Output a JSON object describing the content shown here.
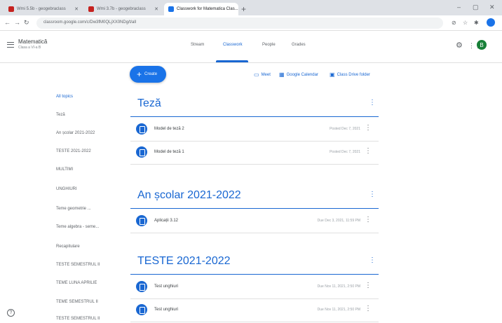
{
  "browser": {
    "tabs": [
      {
        "title": "Wmi 5.5b - geogebraclass",
        "favicon_color": "#c5221f",
        "active": false
      },
      {
        "title": "Wmi 3.7b - geogebraclass",
        "favicon_color": "#c5221f",
        "active": false
      },
      {
        "title": "Classwork for Matematica Clas...",
        "favicon_color": "#1a73e8",
        "active": true
      }
    ],
    "new_tab_symbol": "+",
    "window_controls": {
      "minimize": "–",
      "maximize": "▢",
      "close": "✕"
    },
    "nav": {
      "back": "←",
      "forward": "→",
      "reload": "↻"
    },
    "url": "classroom.google.com/c/Dw3fM0QLjXX0NDg/t/all"
  },
  "header": {
    "class_name": "Matematică",
    "class_section": "Clasa a VI-a B",
    "tabs": [
      {
        "label": "Stream",
        "active": false
      },
      {
        "label": "Classwork",
        "active": true
      },
      {
        "label": "People",
        "active": false
      },
      {
        "label": "Grades",
        "active": false
      }
    ],
    "avatar_letter": "B",
    "avatar_color": "#188038"
  },
  "toolbar": {
    "create_label": "Create",
    "meet_label": "Meet",
    "calendar_label": "Google Calendar",
    "drive_label": "Class Drive folder"
  },
  "topics": [
    {
      "label": "All topics",
      "active": true
    },
    {
      "label": "Teză",
      "active": false
    },
    {
      "label": "An școlar 2021-2022",
      "active": false
    },
    {
      "label": "TESTE 2021-2022",
      "active": false
    },
    {
      "label": "MULTIMI",
      "active": false
    },
    {
      "label": "UNGHIURI",
      "active": false
    },
    {
      "label": "Teme geometrie ...",
      "active": false
    },
    {
      "label": "Teme algebra - seme...",
      "active": false
    },
    {
      "label": "Recapitulare",
      "active": false
    },
    {
      "label": "TESTE SEMESTRUL II",
      "active": false
    },
    {
      "label": "TEME LUNA APRILIE",
      "active": false
    },
    {
      "label": "TEME SEMESTRUL II",
      "active": false
    },
    {
      "label": "TESTE SEMESTRUL II",
      "active": false
    }
  ],
  "sections": [
    {
      "title": "Teză",
      "items": [
        {
          "title": "Model de teză 2",
          "date": "Posted Dec 7, 2021"
        },
        {
          "title": "Model de teză 1",
          "date": "Posted Dec 7, 2021"
        }
      ]
    },
    {
      "title": "An școlar 2021-2022",
      "items": [
        {
          "title": "Aplicații 3.12",
          "date": "Due Dec 3, 2021, 11:59 PM"
        }
      ]
    },
    {
      "title": "TESTE 2021-2022",
      "items": [
        {
          "title": "Test unghiuri",
          "date": "Due Nov 11, 2021, 2:50 PM"
        },
        {
          "title": "Test unghiuri",
          "date": "Due Nov 11, 2021, 2:50 PM"
        }
      ]
    }
  ],
  "help_symbol": "?",
  "accent_color": "#1967d2"
}
